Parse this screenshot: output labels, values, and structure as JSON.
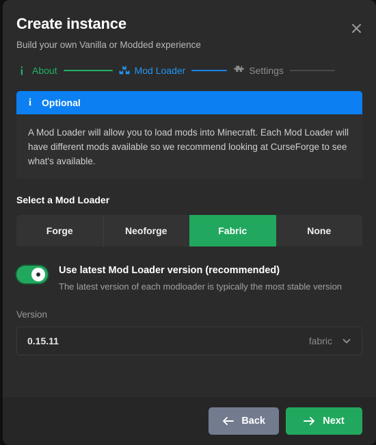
{
  "dialog": {
    "title": "Create instance",
    "subtitle": "Build your own Vanilla or Modded experience",
    "close_icon": "close-icon"
  },
  "stepper": {
    "steps": [
      {
        "label": "About",
        "icon": "info-icon",
        "state": "done",
        "color": "#22b365"
      },
      {
        "label": "Mod Loader",
        "icon": "boxes-icon",
        "state": "active",
        "color": "#2196f3"
      },
      {
        "label": "Settings",
        "icon": "puzzle-piece-icon",
        "state": "todo",
        "color": "#8d8d8d"
      }
    ]
  },
  "info_banner": {
    "icon": "info-icon",
    "heading": "Optional",
    "body": "A Mod Loader will allow you to load mods into Minecraft. Each Mod Loader will have different mods available so we recommend looking at CurseForge to see what's available.",
    "accent_color": "#0c80f2"
  },
  "mod_loader": {
    "section_title": "Select a Mod Loader",
    "options": [
      {
        "label": "Forge",
        "selected": false
      },
      {
        "label": "Neoforge",
        "selected": false
      },
      {
        "label": "Fabric",
        "selected": true
      },
      {
        "label": "None",
        "selected": false
      }
    ],
    "selected_color": "#22a85e"
  },
  "latest_toggle": {
    "label": "Use latest Mod Loader version (recommended)",
    "description": "The latest version of each modloader is typically the most stable version",
    "state": "on",
    "on_color": "#22a85e"
  },
  "version_field": {
    "label": "Version",
    "value": "0.15.11",
    "suffix": "fabric",
    "chevron_icon": "chevron-down-icon"
  },
  "footer": {
    "back_label": "Back",
    "back_icon": "arrow-left-icon",
    "next_label": "Next",
    "next_icon": "arrow-right-icon",
    "next_color": "#22a85e",
    "back_color": "#737b8f"
  }
}
